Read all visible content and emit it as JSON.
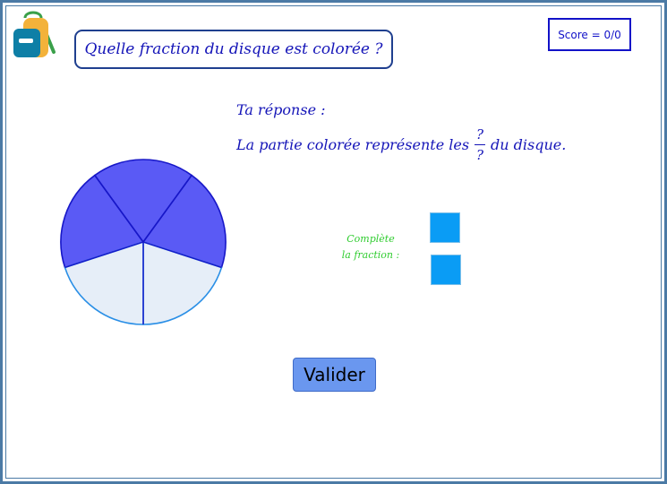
{
  "question": "Quelle fraction du disque est colorée ?",
  "score": "Score = 0/0",
  "answer": {
    "title": "Ta réponse :",
    "sentence_before": "La partie colorée représente les",
    "numerator": "?",
    "denominator": "?",
    "sentence_after": "du disque."
  },
  "complete_label": {
    "line1": "Complète",
    "line2": "la fraction :"
  },
  "validate_label": "Valider",
  "disk": {
    "total_parts": 5,
    "colored_parts": 3,
    "colored_fill": "#5a5af5",
    "colored_stroke": "#1717c8",
    "empty_fill": "#e6eef8",
    "empty_stroke": "#2a8fe6"
  },
  "colors": {
    "text_blue": "#1515b8",
    "label_green": "#2fcc2f",
    "input_blue": "#0a9cf5",
    "button": "#6a97ef",
    "frame": "#4b7aa5"
  },
  "icons": {
    "logo": "backpack-icon"
  }
}
